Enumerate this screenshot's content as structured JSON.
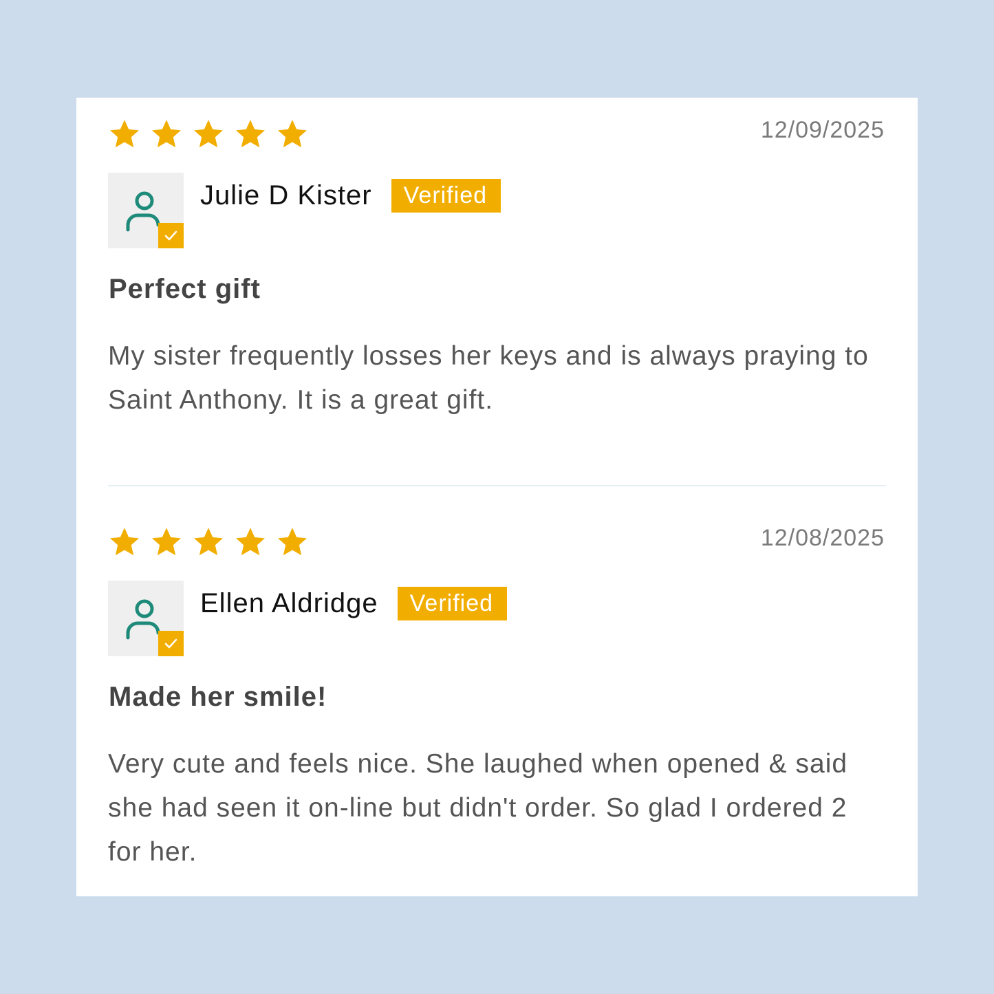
{
  "colors": {
    "background": "#cddced",
    "star": "#f2ae00",
    "badge": "#f2ae00",
    "avatar_icon": "#1e8a7a"
  },
  "reviews": [
    {
      "rating": 5,
      "max_rating": 5,
      "date": "12/09/2025",
      "reviewer": "Julie D Kister",
      "badge": "Verified",
      "avatar_icon": "user-verified-icon",
      "title": "Perfect gift",
      "body": "My sister frequently losses her keys and is always praying to Saint Anthony. It is a great gift."
    },
    {
      "rating": 5,
      "max_rating": 5,
      "date": "12/08/2025",
      "reviewer": "Ellen Aldridge",
      "badge": "Verified",
      "avatar_icon": "user-verified-icon",
      "title": "Made her smile!",
      "body": "Very cute and feels nice. She laughed when opened & said she had seen it on-line but didn't order. So glad I ordered 2 for her."
    }
  ]
}
